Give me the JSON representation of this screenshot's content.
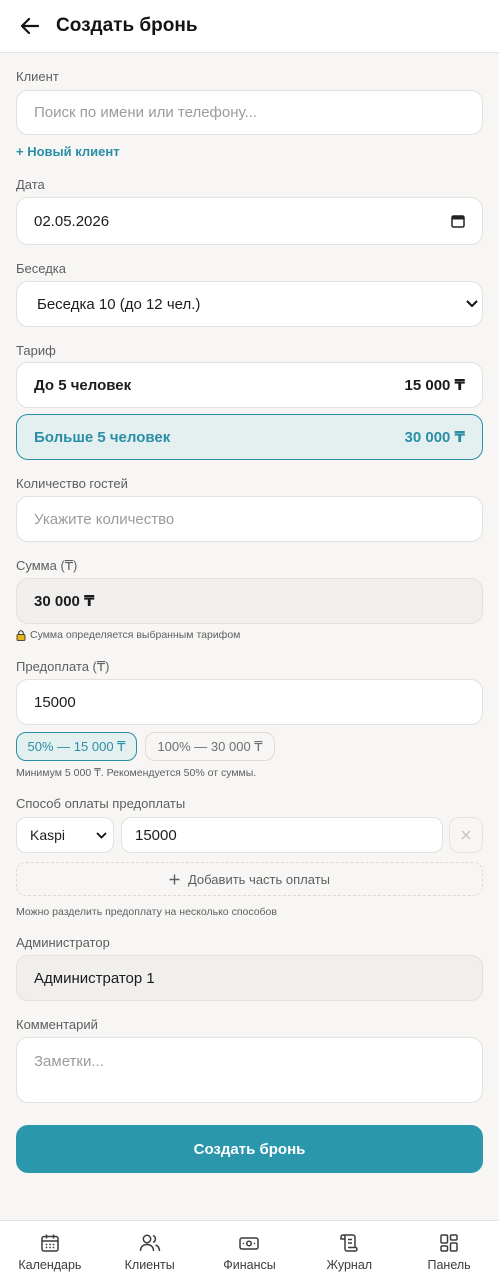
{
  "header": {
    "title": "Создать бронь"
  },
  "client": {
    "label": "Клиент",
    "placeholder": "Поиск по имени или телефону...",
    "new_client_link": "+ Новый клиент"
  },
  "date": {
    "label": "Дата",
    "value": "02.05.2026"
  },
  "gazebo": {
    "label": "Беседка",
    "value": "Беседка 10 (до 12 чел.)"
  },
  "tariff": {
    "label": "Тариф",
    "options": [
      {
        "name": "До 5 человек",
        "price": "15 000 ₸",
        "selected": false
      },
      {
        "name": "Больше 5 человек",
        "price": "30 000 ₸",
        "selected": true
      }
    ]
  },
  "guests": {
    "label": "Количество гостей",
    "placeholder": "Укажите количество"
  },
  "sum": {
    "label": "Сумма (₸)",
    "value": "30 000 ₸",
    "note": "Сумма определяется выбранным тарифом"
  },
  "prepayment": {
    "label": "Предоплата (₸)",
    "value": "15000",
    "chips": [
      "50% — 15 000 ₸",
      "100% — 30 000 ₸"
    ],
    "hint": "Минимум 5 000 ₸. Рекомендуется 50% от суммы."
  },
  "payment_method": {
    "label": "Способ оплаты предоплаты",
    "method": "Kaspi",
    "amount": "15000",
    "add_part": "Добавить часть оплаты",
    "hint": "Можно разделить предоплату на несколько способов"
  },
  "admin": {
    "label": "Администратор",
    "value": "Администратор 1"
  },
  "comment": {
    "label": "Комментарий",
    "placeholder": "Заметки..."
  },
  "submit_label": "Создать бронь",
  "nav": {
    "items": [
      {
        "label": "Календарь",
        "icon": "calendar-icon"
      },
      {
        "label": "Клиенты",
        "icon": "users-icon"
      },
      {
        "label": "Финансы",
        "icon": "money-icon"
      },
      {
        "label": "Журнал",
        "icon": "journal-icon"
      },
      {
        "label": "Панель",
        "icon": "dashboard-icon"
      }
    ]
  },
  "colors": {
    "accent": "#2b97ac",
    "accent_soft": "#e4eff0",
    "background": "#f7f6f4"
  }
}
